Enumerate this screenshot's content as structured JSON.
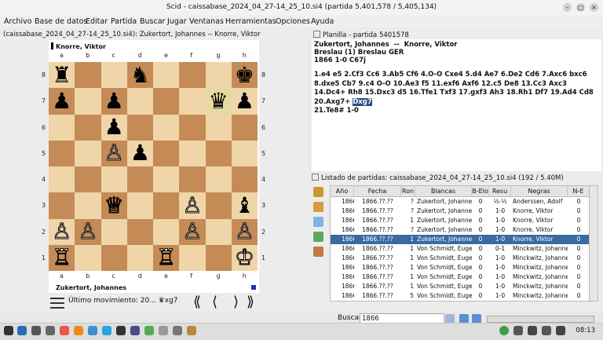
{
  "window": {
    "title": "Scid - caissabase_2024_04_27-14_25_10.si4 (partida 5,401,578 / 5,405,134)"
  },
  "menu": [
    "Archivo",
    "Base de datos",
    "Editar",
    "Partida",
    "Buscar",
    "Jugar",
    "Ventanas",
    "Herramientas",
    "Opciones",
    "Ayuda"
  ],
  "left": {
    "game_title": "(caissabase_2024_04_27-14_25_10.si4): Zukertort, Johannes -- Knorre, Viktor",
    "top_player": "Knorre, Viktor",
    "bottom_player": "Zukertort, Johannes",
    "files": [
      "a",
      "b",
      "c",
      "d",
      "e",
      "f",
      "g",
      "h"
    ],
    "ranks": [
      "8",
      "7",
      "6",
      "5",
      "4",
      "3",
      "2",
      "1"
    ],
    "last_move": "Último movimiento: 20... ♛xg7",
    "board": [
      [
        "♜",
        "",
        "",
        "♞",
        "",
        "",
        "",
        "♚"
      ],
      [
        "♟",
        "",
        "♟",
        "",
        "",
        "",
        "♛",
        "♟"
      ],
      [
        "",
        "",
        "♟",
        "",
        "",
        "",
        "",
        ""
      ],
      [
        "",
        "",
        "♙",
        "♟",
        "",
        "",
        "",
        ""
      ],
      [
        "",
        "",
        "",
        "",
        "",
        "",
        "",
        ""
      ],
      [
        "",
        "",
        "♕",
        "",
        "",
        "♙",
        "",
        "♝"
      ],
      [
        "♙",
        "♙",
        "",
        "",
        "",
        "♙",
        "",
        "♙"
      ],
      [
        "♖",
        "",
        "",
        "",
        "♖",
        "",
        "",
        "♔"
      ]
    ]
  },
  "right": {
    "sheet_title": "Planilla - partida 5401578",
    "white": "Zukertort, Johannes",
    "sep": "--",
    "black": "Knorre, Viktor",
    "event": "Breslau (1)  Breslau GER",
    "info": "1866  1-0  C67j",
    "moves": "1.e4 e5 2.Cf3 Cc6 3.Ab5 Cf6 4.O-O Cxe4 5.d4 Ae7 6.De2 Cd6 7.Axc6 bxc6 8.dxe5 Cb7 9.c4 O-O 10.Ae3 f5 11.exf6 Axf6 12.c5 De8 13.Cc3 Axc3 14.Dc4+ Rh8 15.Dxc3 d5 16.Tfe1 Txf3 17.gxf3 Ah3 18.Rh1 Df7 19.Ad4 Cd8 20.Axg7+",
    "current_move": "Dxg7",
    "moves_end": "21.Te8# 1-0",
    "list_title": "Listado de partidas: caissabase_2024_04_27-14_25_10.si4 (192 / 5.40M)",
    "columns": [
      "Año",
      "Fecha",
      "Ron",
      "Blancas",
      "B-Elo",
      "Resu",
      "Negras",
      "N-E"
    ],
    "rows": [
      [
        "1866",
        "1866.??.??",
        "?",
        "Zukertort, Johanne",
        "0",
        "½-½",
        "Anderssen, Adolf",
        "0"
      ],
      [
        "1866",
        "1866.??.??",
        "?",
        "Zukertort, Johanne",
        "0",
        "1-0",
        "Knorre, Viktor",
        "0"
      ],
      [
        "1866",
        "1866.??.??",
        "1",
        "Zukertort, Johanne",
        "0",
        "1-0",
        "Knorre, Viktor",
        "0"
      ],
      [
        "1866",
        "1866.??.??",
        "?",
        "Zukertort, Johanne",
        "0",
        "1-0",
        "Knorre, Viktor",
        "0"
      ],
      [
        "1866",
        "1866.??.??",
        "1",
        "Zukertort, Johanne",
        "0",
        "1-0",
        "Knorre, Viktor",
        "0"
      ],
      [
        "1866",
        "1866.??.??",
        "1",
        "Von Schmidt, Euge",
        "0",
        "0-1",
        "Minckwitz, Johanne",
        "0"
      ],
      [
        "1866",
        "1866.??.??",
        "1",
        "Von Schmidt, Euge",
        "0",
        "1-0",
        "Minckwitz, Johanne",
        "0"
      ],
      [
        "1866",
        "1866.??.??",
        "1",
        "Von Schmidt, Euge",
        "0",
        "1-0",
        "Minckwitz, Johanne",
        "0"
      ],
      [
        "1866",
        "1866.??.??",
        "1",
        "Von Schmidt, Euge",
        "0",
        "1-0",
        "Minckwitz, Johanne",
        "0"
      ],
      [
        "1866",
        "1866.??.??",
        "1",
        "Von Schmidt, Euge",
        "0",
        "1-0",
        "Minckwitz, Johanne",
        "0"
      ],
      [
        "1866",
        "1866.??.??",
        "5",
        "Von Schmidt, Euge",
        "0",
        "1-0",
        "Minckwitz, Johanne",
        "0"
      ]
    ],
    "selected_row": 4,
    "search_label": "Buscar",
    "search_value": "1866"
  },
  "taskbar": {
    "clock": "08:13"
  }
}
